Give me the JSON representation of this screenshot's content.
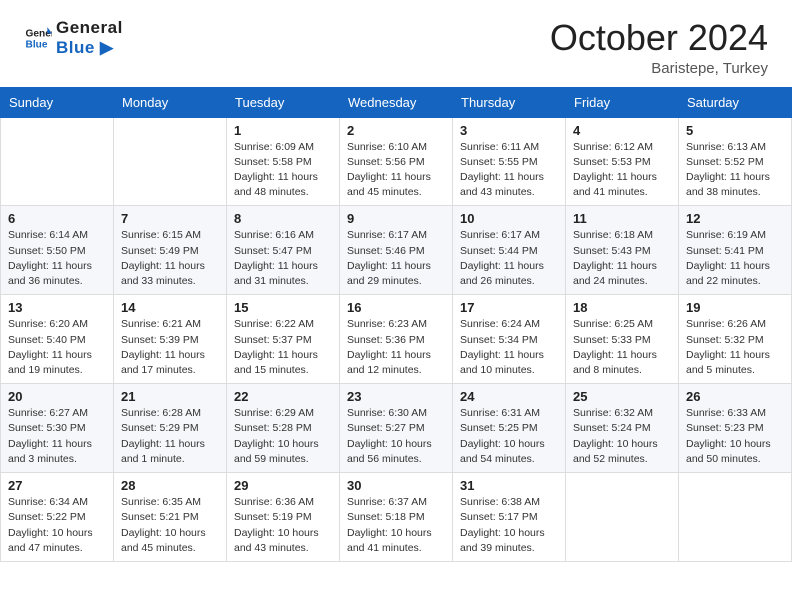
{
  "header": {
    "logo_line1": "General",
    "logo_line2": "Blue",
    "month": "October 2024",
    "location": "Baristepe, Turkey"
  },
  "weekdays": [
    "Sunday",
    "Monday",
    "Tuesday",
    "Wednesday",
    "Thursday",
    "Friday",
    "Saturday"
  ],
  "weeks": [
    [
      {
        "day": "",
        "info": ""
      },
      {
        "day": "",
        "info": ""
      },
      {
        "day": "1",
        "info": "Sunrise: 6:09 AM\nSunset: 5:58 PM\nDaylight: 11 hours and 48 minutes."
      },
      {
        "day": "2",
        "info": "Sunrise: 6:10 AM\nSunset: 5:56 PM\nDaylight: 11 hours and 45 minutes."
      },
      {
        "day": "3",
        "info": "Sunrise: 6:11 AM\nSunset: 5:55 PM\nDaylight: 11 hours and 43 minutes."
      },
      {
        "day": "4",
        "info": "Sunrise: 6:12 AM\nSunset: 5:53 PM\nDaylight: 11 hours and 41 minutes."
      },
      {
        "day": "5",
        "info": "Sunrise: 6:13 AM\nSunset: 5:52 PM\nDaylight: 11 hours and 38 minutes."
      }
    ],
    [
      {
        "day": "6",
        "info": "Sunrise: 6:14 AM\nSunset: 5:50 PM\nDaylight: 11 hours and 36 minutes."
      },
      {
        "day": "7",
        "info": "Sunrise: 6:15 AM\nSunset: 5:49 PM\nDaylight: 11 hours and 33 minutes."
      },
      {
        "day": "8",
        "info": "Sunrise: 6:16 AM\nSunset: 5:47 PM\nDaylight: 11 hours and 31 minutes."
      },
      {
        "day": "9",
        "info": "Sunrise: 6:17 AM\nSunset: 5:46 PM\nDaylight: 11 hours and 29 minutes."
      },
      {
        "day": "10",
        "info": "Sunrise: 6:17 AM\nSunset: 5:44 PM\nDaylight: 11 hours and 26 minutes."
      },
      {
        "day": "11",
        "info": "Sunrise: 6:18 AM\nSunset: 5:43 PM\nDaylight: 11 hours and 24 minutes."
      },
      {
        "day": "12",
        "info": "Sunrise: 6:19 AM\nSunset: 5:41 PM\nDaylight: 11 hours and 22 minutes."
      }
    ],
    [
      {
        "day": "13",
        "info": "Sunrise: 6:20 AM\nSunset: 5:40 PM\nDaylight: 11 hours and 19 minutes."
      },
      {
        "day": "14",
        "info": "Sunrise: 6:21 AM\nSunset: 5:39 PM\nDaylight: 11 hours and 17 minutes."
      },
      {
        "day": "15",
        "info": "Sunrise: 6:22 AM\nSunset: 5:37 PM\nDaylight: 11 hours and 15 minutes."
      },
      {
        "day": "16",
        "info": "Sunrise: 6:23 AM\nSunset: 5:36 PM\nDaylight: 11 hours and 12 minutes."
      },
      {
        "day": "17",
        "info": "Sunrise: 6:24 AM\nSunset: 5:34 PM\nDaylight: 11 hours and 10 minutes."
      },
      {
        "day": "18",
        "info": "Sunrise: 6:25 AM\nSunset: 5:33 PM\nDaylight: 11 hours and 8 minutes."
      },
      {
        "day": "19",
        "info": "Sunrise: 6:26 AM\nSunset: 5:32 PM\nDaylight: 11 hours and 5 minutes."
      }
    ],
    [
      {
        "day": "20",
        "info": "Sunrise: 6:27 AM\nSunset: 5:30 PM\nDaylight: 11 hours and 3 minutes."
      },
      {
        "day": "21",
        "info": "Sunrise: 6:28 AM\nSunset: 5:29 PM\nDaylight: 11 hours and 1 minute."
      },
      {
        "day": "22",
        "info": "Sunrise: 6:29 AM\nSunset: 5:28 PM\nDaylight: 10 hours and 59 minutes."
      },
      {
        "day": "23",
        "info": "Sunrise: 6:30 AM\nSunset: 5:27 PM\nDaylight: 10 hours and 56 minutes."
      },
      {
        "day": "24",
        "info": "Sunrise: 6:31 AM\nSunset: 5:25 PM\nDaylight: 10 hours and 54 minutes."
      },
      {
        "day": "25",
        "info": "Sunrise: 6:32 AM\nSunset: 5:24 PM\nDaylight: 10 hours and 52 minutes."
      },
      {
        "day": "26",
        "info": "Sunrise: 6:33 AM\nSunset: 5:23 PM\nDaylight: 10 hours and 50 minutes."
      }
    ],
    [
      {
        "day": "27",
        "info": "Sunrise: 6:34 AM\nSunset: 5:22 PM\nDaylight: 10 hours and 47 minutes."
      },
      {
        "day": "28",
        "info": "Sunrise: 6:35 AM\nSunset: 5:21 PM\nDaylight: 10 hours and 45 minutes."
      },
      {
        "day": "29",
        "info": "Sunrise: 6:36 AM\nSunset: 5:19 PM\nDaylight: 10 hours and 43 minutes."
      },
      {
        "day": "30",
        "info": "Sunrise: 6:37 AM\nSunset: 5:18 PM\nDaylight: 10 hours and 41 minutes."
      },
      {
        "day": "31",
        "info": "Sunrise: 6:38 AM\nSunset: 5:17 PM\nDaylight: 10 hours and 39 minutes."
      },
      {
        "day": "",
        "info": ""
      },
      {
        "day": "",
        "info": ""
      }
    ]
  ]
}
